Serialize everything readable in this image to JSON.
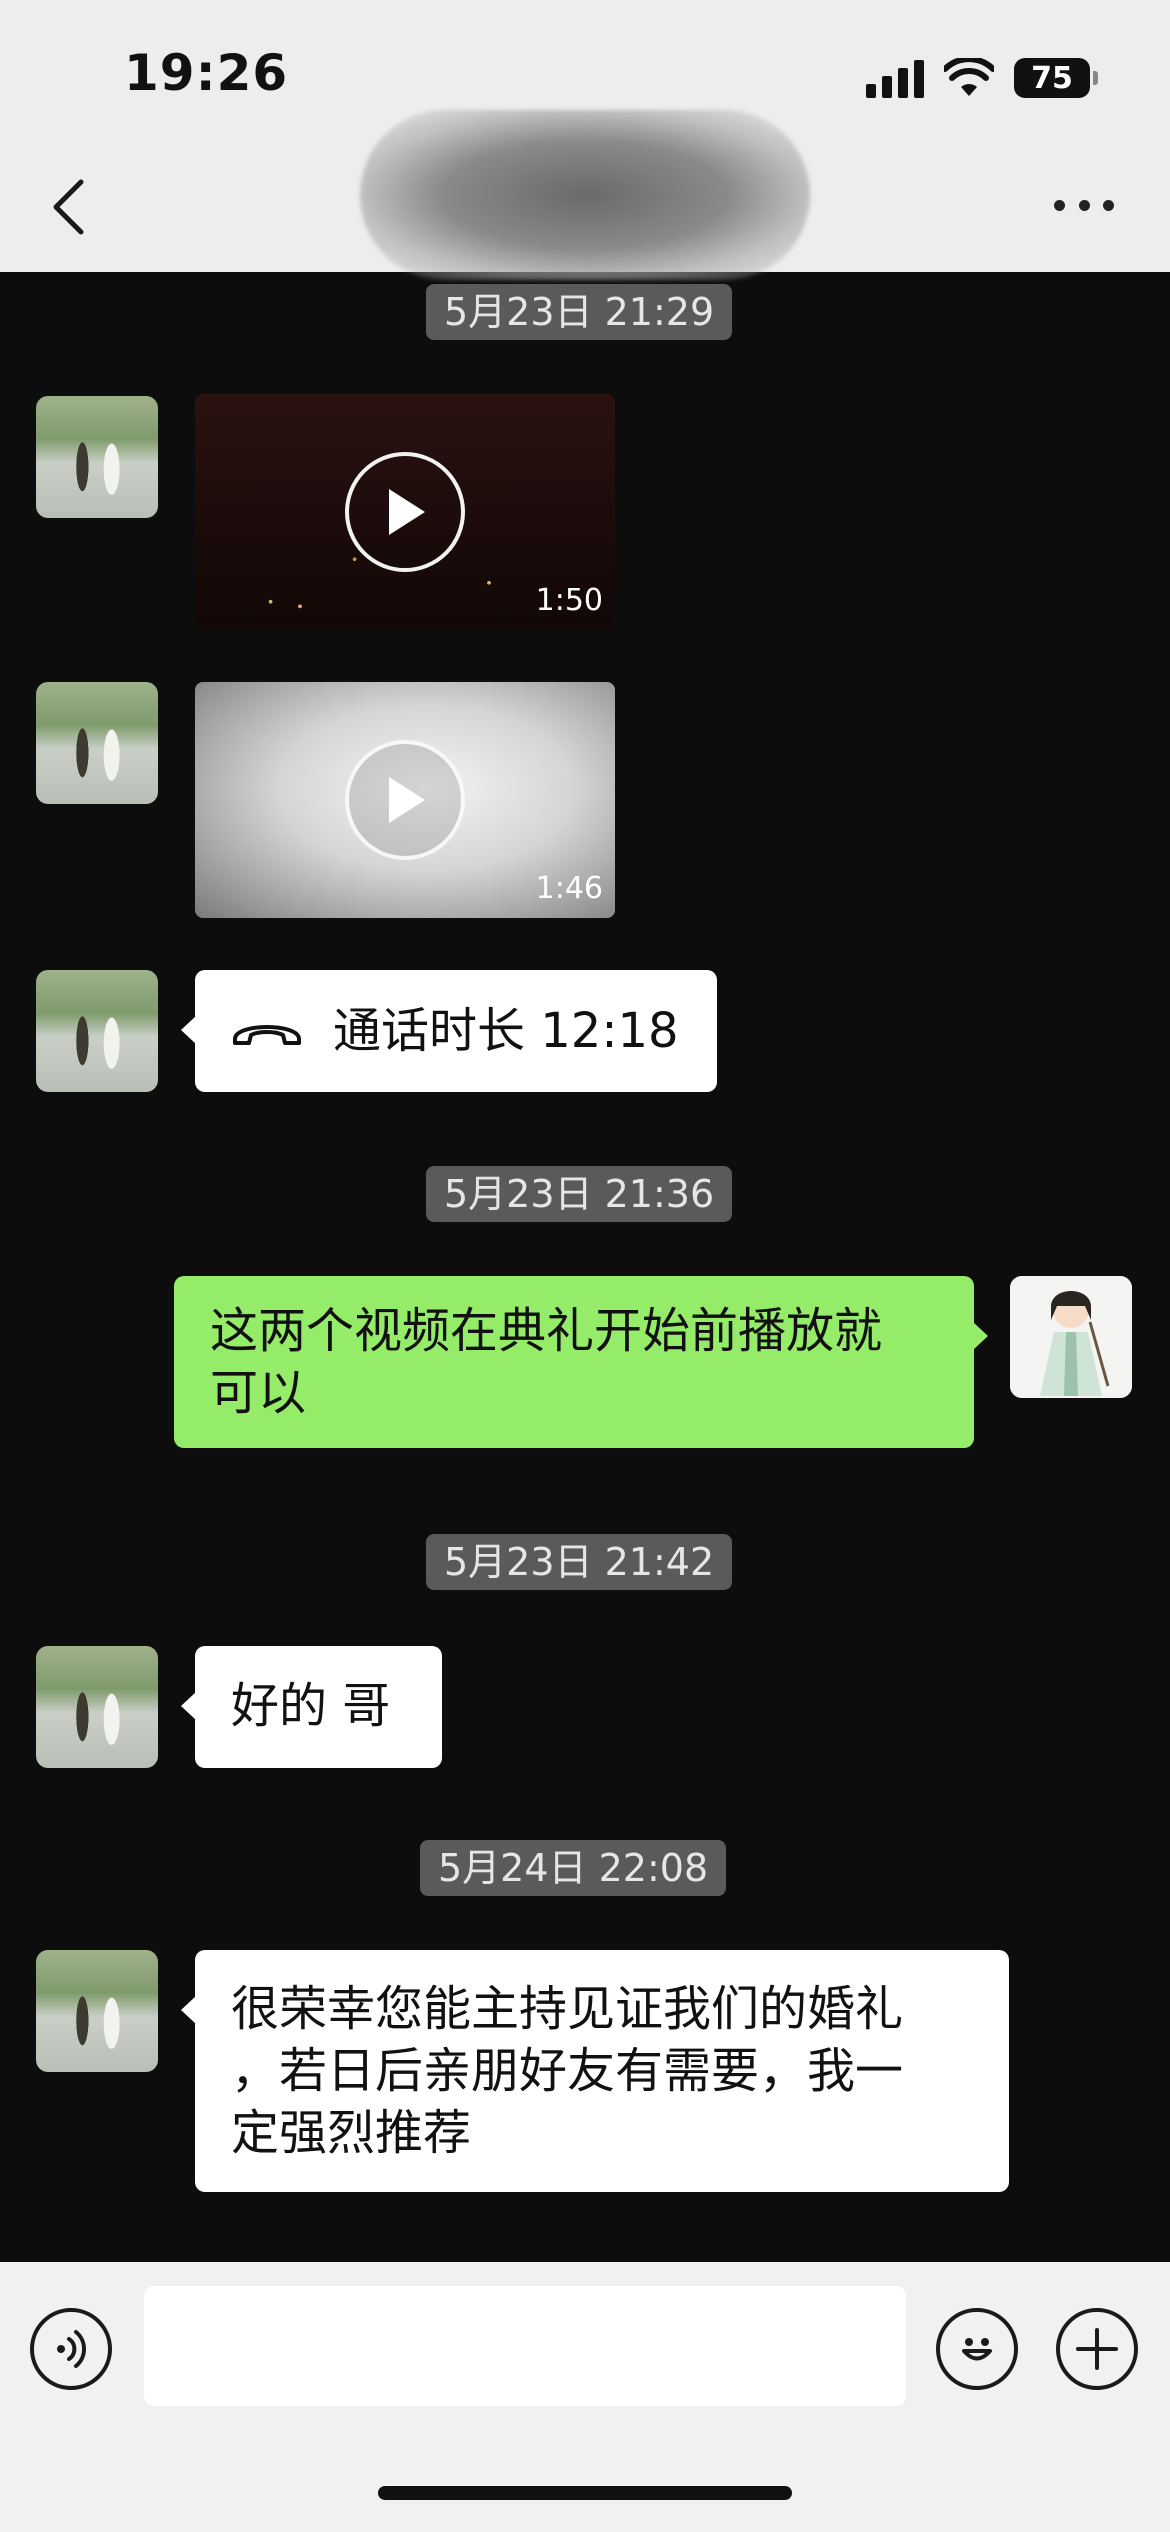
{
  "status_bar": {
    "time": "19:26",
    "battery": "75",
    "icons": [
      "cellular-signal-icon",
      "wifi-icon",
      "battery-icon"
    ]
  },
  "nav": {
    "back_icon": "chevron-left-icon",
    "title": "",
    "more_icon": "more-dots-icon"
  },
  "messages": [
    {
      "type": "timestamp",
      "text": "5月23日 21:29"
    },
    {
      "type": "video",
      "direction": "incoming",
      "duration": "1:50",
      "icon": "play-icon"
    },
    {
      "type": "video",
      "direction": "incoming",
      "duration": "1:46",
      "icon": "play-icon"
    },
    {
      "type": "call",
      "direction": "incoming",
      "icon": "phone-hangup-icon",
      "text": "通话时长 12:18"
    },
    {
      "type": "timestamp",
      "text": "5月23日 21:36"
    },
    {
      "type": "text",
      "direction": "outgoing",
      "lines": [
        "这两个视频在典礼开始前播放就",
        "可以"
      ]
    },
    {
      "type": "timestamp",
      "text": "5月23日 21:42"
    },
    {
      "type": "text",
      "direction": "incoming",
      "lines": [
        "好的 哥"
      ]
    },
    {
      "type": "timestamp",
      "text": "5月24日 22:08"
    },
    {
      "type": "text",
      "direction": "incoming",
      "lines": [
        "很荣幸您能主持见证我们的婚礼",
        "，若日后亲朋好友有需要，我一",
        "定强烈推荐"
      ]
    }
  ],
  "input_bar": {
    "voice_icon": "voice-input-icon",
    "input_value": "",
    "emoji_icon": "emoji-icon",
    "plus_icon": "plus-icon"
  },
  "colors": {
    "chat_background": "#0d0d0d",
    "outgoing_bubble": "#95ec69",
    "incoming_bubble": "#ffffff",
    "timestamp_bg": "#5a5a5a"
  }
}
